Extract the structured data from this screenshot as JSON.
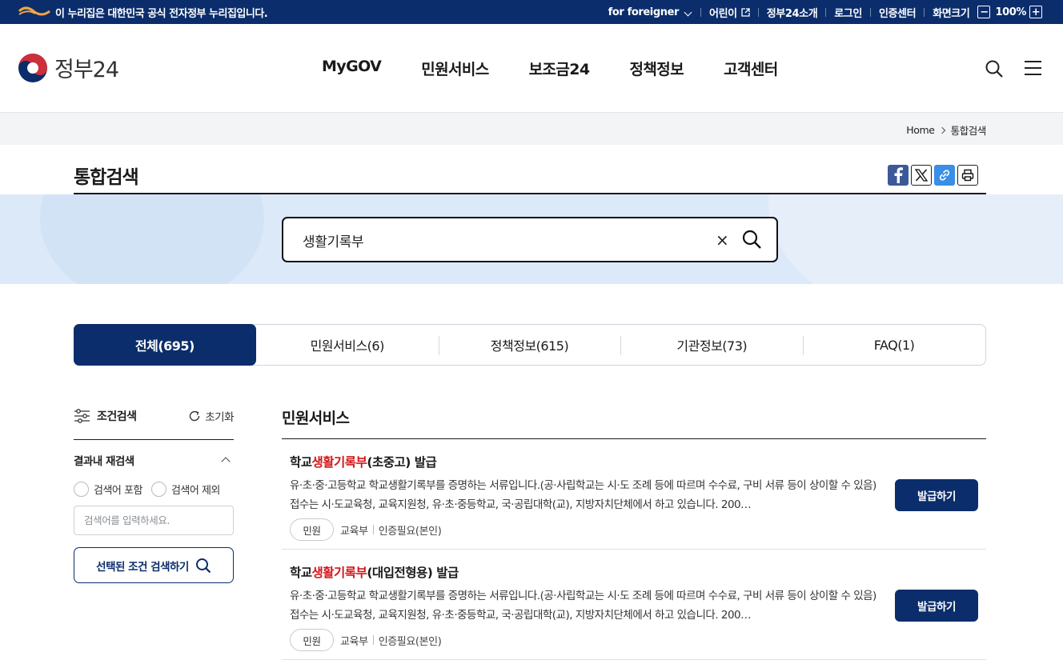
{
  "gov_banner": {
    "text": "이 누리집은 대한민국 공식 전자정부 누리집입니다."
  },
  "util": {
    "foreigner": "for foreigner",
    "kids": "어린이",
    "about": "정부24소개",
    "login": "로그인",
    "cert": "인증센터",
    "zoom_label": "화면크기",
    "zoom_minus": "−",
    "zoom_value": "100%",
    "zoom_plus": "+"
  },
  "header": {
    "logo_text": "정부24",
    "nav": [
      "MyGOV",
      "민원서비스",
      "보조금24",
      "정책정보",
      "고객센터"
    ]
  },
  "breadcrumb": {
    "home": "Home",
    "current": "통합검색"
  },
  "page": {
    "title": "통합검색"
  },
  "search": {
    "value": "생활기록부",
    "clear": "×"
  },
  "tabs": [
    {
      "label": "전체(695)",
      "active": true
    },
    {
      "label": "민원서비스(6)"
    },
    {
      "label": "정책정보(615)"
    },
    {
      "label": "기관정보(73)"
    },
    {
      "label": "FAQ(1)"
    }
  ],
  "filter": {
    "title": "조건검색",
    "reset": "초기화",
    "subtitle": "결과내 재검색",
    "include": "검색어 포함",
    "exclude": "검색어 제외",
    "placeholder": "검색어를 입력하세요.",
    "apply": "선택된 조건 검색하기"
  },
  "results": {
    "section_title": "민원서비스",
    "items": [
      {
        "title_prefix": "학교",
        "title_highlight": "생활기록부",
        "title_suffix": "(초중고) 발급",
        "desc": "유·초·중·고등학교 학교생활기록부를 증명하는 서류입니다.(공·사립학교는 시·도 조례 등에 따르며 수수료, 구비 서류 등이 상이할 수 있음) 접수는 시·도교육청, 교육지원청, 유·초·중등학교, 국·공립대학(교), 지방자치단체에서 하고 있습니다. 200…",
        "badge": "민원",
        "agency": "교육부",
        "auth": "인증필요(본인)",
        "button": "발급하기"
      },
      {
        "title_prefix": "학교",
        "title_highlight": "생활기록부",
        "title_suffix": "(대입전형용) 발급",
        "desc": "유·초·중·고등학교 학교생활기록부를 증명하는 서류입니다.(공·사립학교는 시·도 조례 등에 따르며 수수료, 구비 서류 등이 상이할 수 있음) 접수는 시·도교육청, 교육지원청, 유·초·중등학교, 국·공립대학(교), 지방자치단체에서 하고 있습니다. 200…",
        "badge": "민원",
        "agency": "교육부",
        "auth": "인증필요(본인)",
        "button": "발급하기"
      }
    ]
  },
  "colors": {
    "navy": "#0b2d6b",
    "highlight": "#d4141a",
    "band": "#dce9f8"
  },
  "icons": [
    "eg-emblem-icon",
    "external-link-icon",
    "taegeuk-logo-icon",
    "search-icon",
    "hamburger-menu-icon",
    "facebook-icon",
    "x-twitter-icon",
    "link-icon",
    "print-icon",
    "filter-sliders-icon",
    "refresh-icon",
    "chevron-up-icon"
  ]
}
